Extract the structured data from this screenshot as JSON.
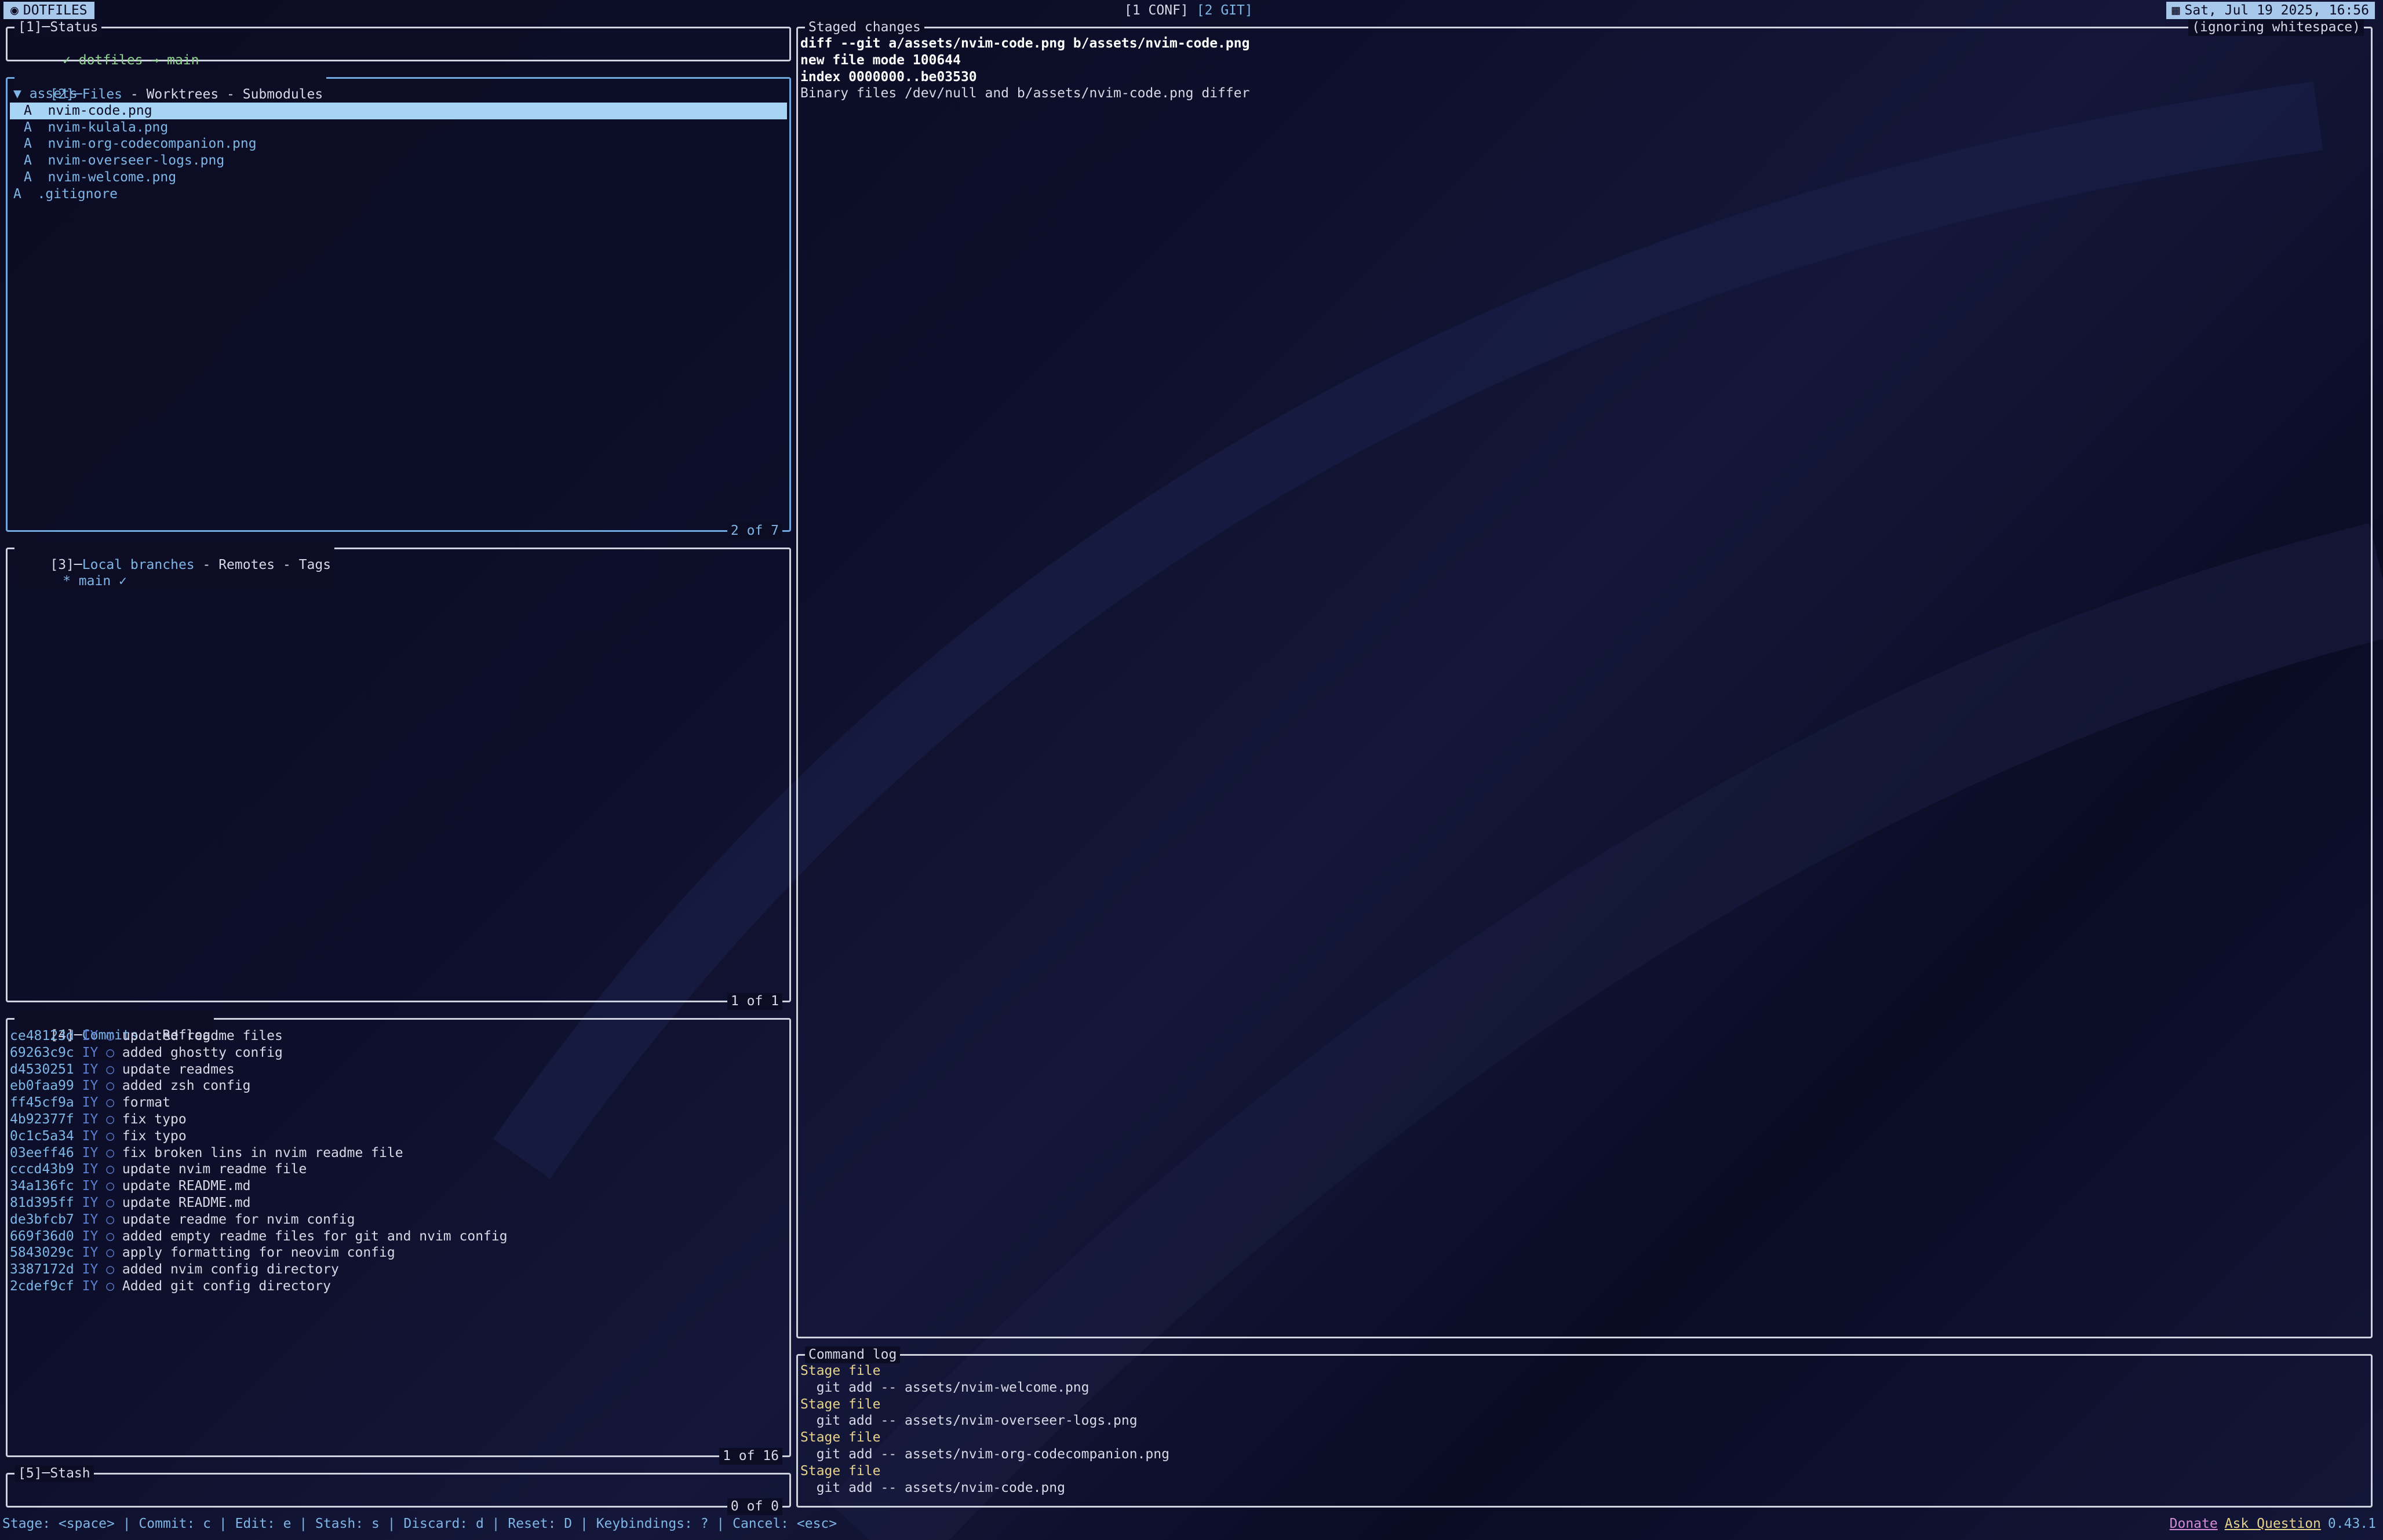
{
  "topbar": {
    "workspace_label": "DOTFILES",
    "tabs": [
      "[1 CONF]",
      "[2 GIT]"
    ],
    "clock": "Sat, Jul 19 2025, 16:56"
  },
  "status_panel": {
    "title": "[1]─Status",
    "line": "✓ dotfiles → main"
  },
  "files_panel": {
    "title_num": "[2]─",
    "title_active": "Files",
    "title_rest": " - Worktrees - Submodules",
    "footer": "2 of 7",
    "items": [
      {
        "text": "▼ assets",
        "indent": 0,
        "selected": false,
        "kind": "dir"
      },
      {
        "text": "A  nvim-code.png",
        "indent": 1,
        "selected": true,
        "kind": "file"
      },
      {
        "text": "A  nvim-kulala.png",
        "indent": 1,
        "selected": false,
        "kind": "file"
      },
      {
        "text": "A  nvim-org-codecompanion.png",
        "indent": 1,
        "selected": false,
        "kind": "file"
      },
      {
        "text": "A  nvim-overseer-logs.png",
        "indent": 1,
        "selected": false,
        "kind": "file"
      },
      {
        "text": "A  nvim-welcome.png",
        "indent": 1,
        "selected": false,
        "kind": "file"
      },
      {
        "text": "A  .gitignore",
        "indent": 0,
        "selected": false,
        "kind": "file"
      }
    ]
  },
  "branches_panel": {
    "title_num": "[3]─",
    "title_active": "Local branches",
    "title_rest": " - Remotes - Tags",
    "footer": "1 of 1",
    "items": [
      "* main ✓"
    ]
  },
  "commits_panel": {
    "title_num": "[4]─",
    "title_active": "Commits",
    "title_rest": " - Reflog",
    "footer": "1 of 16",
    "commits": [
      {
        "hash": "ce48123d",
        "author": "IY",
        "msg": "updated readme files"
      },
      {
        "hash": "69263c9c",
        "author": "IY",
        "msg": "added ghostty config"
      },
      {
        "hash": "d4530251",
        "author": "IY",
        "msg": "update readmes"
      },
      {
        "hash": "eb0faa99",
        "author": "IY",
        "msg": "added zsh config"
      },
      {
        "hash": "ff45cf9a",
        "author": "IY",
        "msg": "format"
      },
      {
        "hash": "4b92377f",
        "author": "IY",
        "msg": "fix typo"
      },
      {
        "hash": "0c1c5a34",
        "author": "IY",
        "msg": "fix typo"
      },
      {
        "hash": "03eeff46",
        "author": "IY",
        "msg": "fix broken lins in nvim readme file"
      },
      {
        "hash": "cccd43b9",
        "author": "IY",
        "msg": "update nvim readme file"
      },
      {
        "hash": "34a136fc",
        "author": "IY",
        "msg": "update README.md"
      },
      {
        "hash": "81d395ff",
        "author": "IY",
        "msg": "update README.md"
      },
      {
        "hash": "de3bfcb7",
        "author": "IY",
        "msg": "update readme for nvim config"
      },
      {
        "hash": "669f36d0",
        "author": "IY",
        "msg": "added empty readme files for git and nvim config"
      },
      {
        "hash": "5843029c",
        "author": "IY",
        "msg": "apply formatting for neovim config"
      },
      {
        "hash": "3387172d",
        "author": "IY",
        "msg": "added nvim config directory"
      },
      {
        "hash": "2cdef9cf",
        "author": "IY",
        "msg": "Added git config directory"
      }
    ],
    "commit_dot": "○"
  },
  "stash_panel": {
    "title": "[5]─Stash",
    "footer": "0 of 0"
  },
  "diff_panel": {
    "title": "Staged changes",
    "right_title": "(ignoring whitespace)",
    "lines": [
      "diff --git a/assets/nvim-code.png b/assets/nvim-code.png",
      "new file mode 100644",
      "index 0000000..be03530",
      "Binary files /dev/null and b/assets/nvim-code.png differ"
    ]
  },
  "command_log": {
    "title": "Command log",
    "entries": [
      {
        "label": "Stage file",
        "cmd": "  git add -- assets/nvim-welcome.png"
      },
      {
        "label": "Stage file",
        "cmd": "  git add -- assets/nvim-overseer-logs.png"
      },
      {
        "label": "Stage file",
        "cmd": "  git add -- assets/nvim-org-codecompanion.png"
      },
      {
        "label": "Stage file",
        "cmd": "  git add -- assets/nvim-code.png"
      }
    ]
  },
  "bottombar": {
    "keybindings": "Stage: <space> | Commit: c | Edit: e | Stash: s | Discard: d | Reset: D | Keybindings: ? | Cancel: <esc>",
    "donate": "Donate",
    "ask": "Ask Question",
    "version": "0.43.1"
  },
  "colors": {
    "accent_blue": "#7eb6e6",
    "active_border": "#6fa8dc",
    "selection_bg": "#a7d3f5",
    "label_yellow": "#e6d28a",
    "donate_pink": "#d58ad8"
  }
}
